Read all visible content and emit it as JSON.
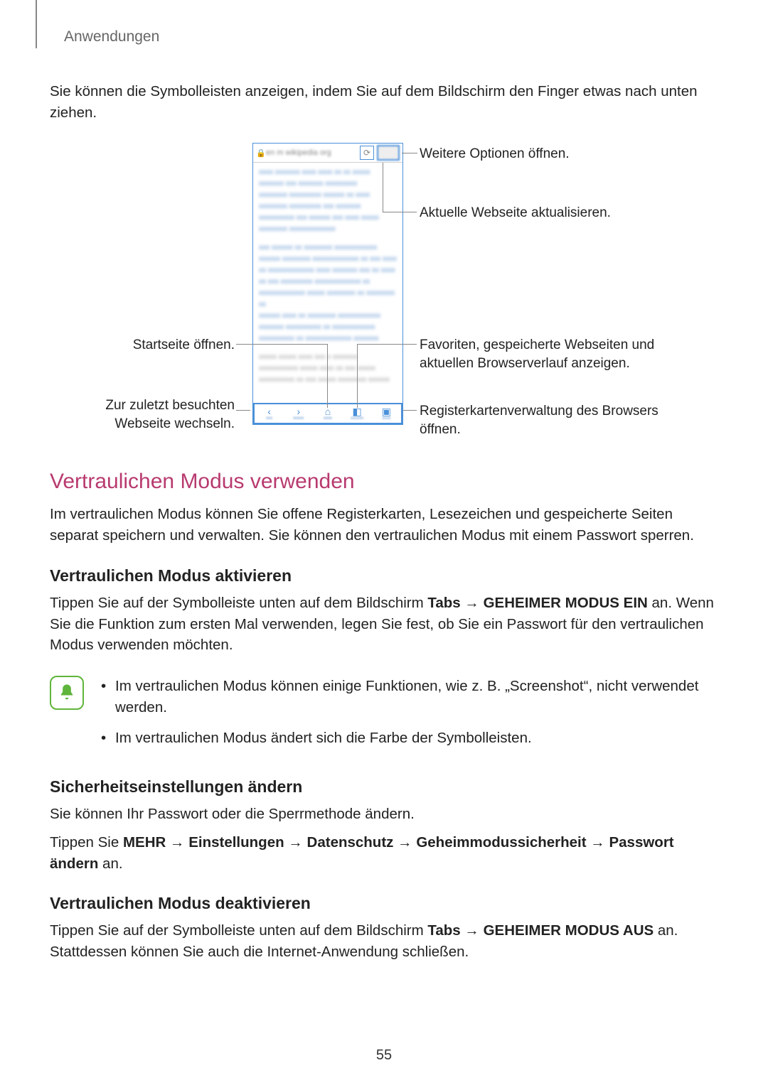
{
  "chapter": "Anwendungen",
  "intro": "Sie können die Symbolleisten anzeigen, indem Sie auf dem Bildschirm den Finger etwas nach unten ziehen.",
  "callouts": {
    "more_options": "Weitere Optionen öffnen.",
    "refresh": "Aktuelle Webseite aktualisieren.",
    "home": "Startseite öffnen.",
    "bookmarks": "Favoriten, gespeicherte Webseiten und aktuellen Browserverlauf anzeigen.",
    "back": "Zur zuletzt besuchten Webseite wechseln.",
    "tabs": "Registerkartenverwaltung des Browsers öffnen."
  },
  "section1": {
    "heading": "Vertraulichen Modus verwenden",
    "p": "Im vertraulichen Modus können Sie offene Registerkarten, Lesezeichen und gespeicherte Seiten separat speichern und verwalten. Sie können den vertraulichen Modus mit einem Passwort sperren."
  },
  "activate": {
    "heading": "Vertraulichen Modus aktivieren",
    "p_pre": "Tippen Sie auf der Symbolleiste unten auf dem Bildschirm ",
    "p_bold1": "Tabs",
    "p_arrow": " → ",
    "p_bold2": "GEHEIMER MODUS EIN",
    "p_post": " an. Wenn Sie die Funktion zum ersten Mal verwenden, legen Sie fest, ob Sie ein Passwort für den vertraulichen Modus verwenden möchten.",
    "note1": "Im vertraulichen Modus können einige Funktionen, wie z. B. „Screenshot“, nicht verwendet werden.",
    "note2": "Im vertraulichen Modus ändert sich die Farbe der Symbolleisten."
  },
  "security": {
    "heading": "Sicherheitseinstellungen ändern",
    "p1": "Sie können Ihr Passwort oder die Sperrmethode ändern.",
    "p2_pre": "Tippen Sie ",
    "p2_b1": "MEHR",
    "p2_b2": "Einstellungen",
    "p2_b3": "Datenschutz",
    "p2_b4": "Geheimmodussicherheit",
    "p2_b5": "Passwort ändern",
    "p2_post": " an."
  },
  "deactivate": {
    "heading": "Vertraulichen Modus deaktivieren",
    "p_pre": "Tippen Sie auf der Symbolleiste unten auf dem Bildschirm ",
    "p_b1": "Tabs",
    "p_b2": "GEHEIMER MODUS AUS",
    "p_post": " an. Stattdessen können Sie auch die Internet-Anwendung schließen."
  },
  "page_number": "55",
  "arrow": " → "
}
